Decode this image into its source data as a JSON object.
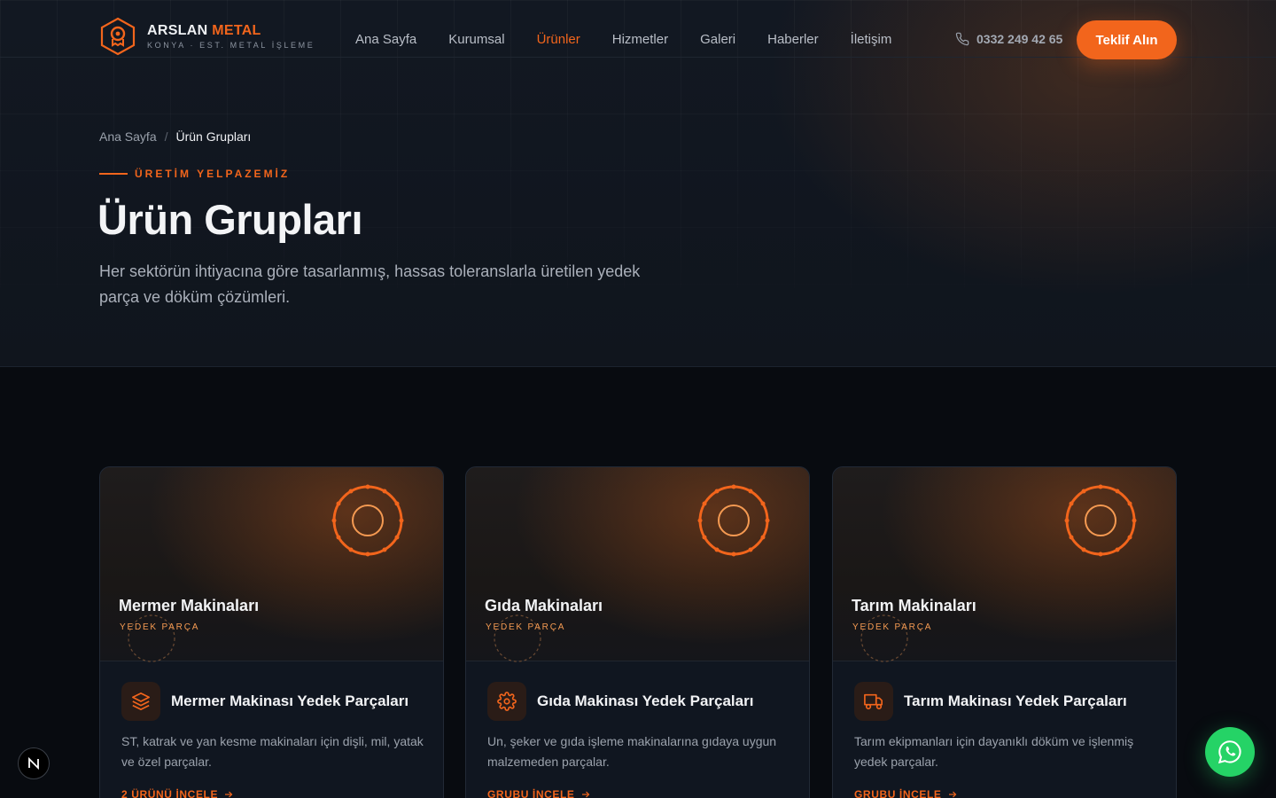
{
  "header": {
    "brand_main": "ARSLAN",
    "brand_accent": "METAL",
    "brand_sub": "KONYA · EST. METAL İŞLEME",
    "nav": [
      {
        "label": "Ana Sayfa",
        "active": false
      },
      {
        "label": "Kurumsal",
        "active": false
      },
      {
        "label": "Ürünler",
        "active": true
      },
      {
        "label": "Hizmetler",
        "active": false
      },
      {
        "label": "Galeri",
        "active": false
      },
      {
        "label": "Haberler",
        "active": false
      },
      {
        "label": "İletişim",
        "active": false
      }
    ],
    "phone": "0332 249 42 65",
    "cta_label": "Teklif Alın"
  },
  "breadcrumb": {
    "home": "Ana Sayfa",
    "separator": "/",
    "current": "Ürün Grupları"
  },
  "hero": {
    "eyebrow": "ÜRETİM YELPAZEMİZ",
    "title": "Ürün Grupları",
    "description": "Her sektörün ihtiyacına göre tasarlanmış, hassas toleranslarla üretilen yedek parça ve döküm çözümleri."
  },
  "cards": [
    {
      "name": "Mermer Makinaları",
      "tag": "YEDEK PARÇA",
      "icon": "layers-icon",
      "heading": "Mermer Makinası Yedek Parçaları",
      "text": "ST, katrak ve yan kesme makinaları için dişli, mil, yatak ve özel parçalar.",
      "link": "2 ÜRÜNÜ İNCELE"
    },
    {
      "name": "Gıda Makinaları",
      "tag": "YEDEK PARÇA",
      "icon": "gear-icon",
      "heading": "Gıda Makinası Yedek Parçaları",
      "text": "Un, şeker ve gıda işleme makinalarına gıdaya uygun malzemeden parçalar.",
      "link": "GRUBU İNCELE"
    },
    {
      "name": "Tarım Makinaları",
      "tag": "YEDEK PARÇA",
      "icon": "truck-icon",
      "heading": "Tarım Makinası Yedek Parçaları",
      "text": "Tarım ekipmanları için dayanıklı döküm ve işlenmiş yedek parçalar.",
      "link": "GRUBU İNCELE"
    }
  ],
  "colors": {
    "accent": "#f2651c",
    "background": "#080b10",
    "whatsapp": "#25d366"
  },
  "floating": {
    "dev_badge_icon": "next-logo-icon",
    "whatsapp_icon": "whatsapp-icon"
  }
}
